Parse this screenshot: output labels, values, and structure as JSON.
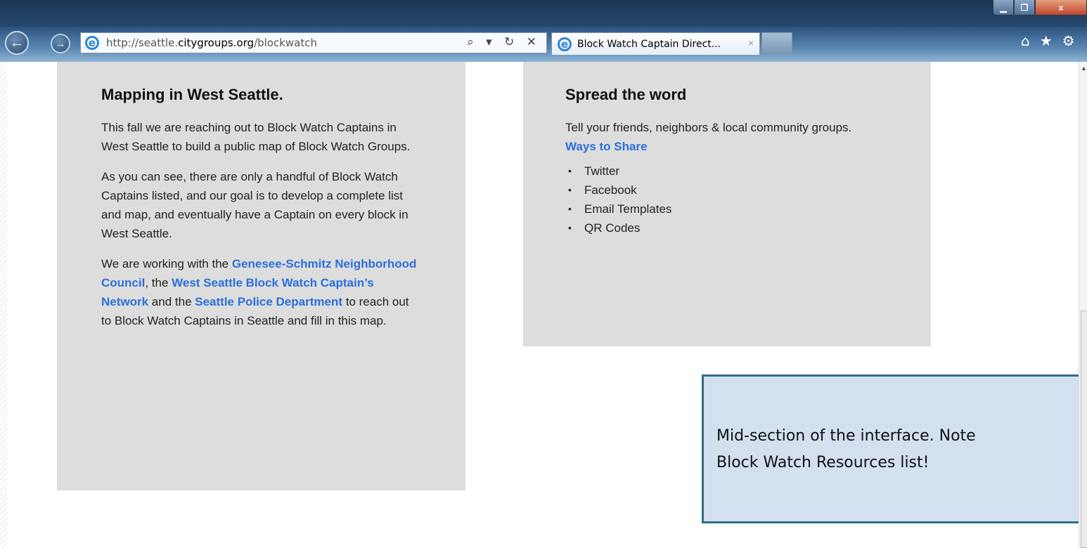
{
  "browser": {
    "address_protocol": "http://seattle.",
    "address_host": "citygroups.org",
    "address_path": "/blockwatch",
    "tab_title": "Block Watch Captain Direct...",
    "tab_close": "×",
    "addr_tools": "⌕ ▾ ↻ ✕",
    "window_close": "x"
  },
  "left_card": {
    "heading": "Mapping in West Seattle.",
    "para1": "This fall we are reaching out to Block Watch Captains in West Seattle to build a public map of Block Watch Groups.",
    "para2": "As you can see, there are only a handful of Block Watch Captains listed, and our goal is to develop a complete list and map, and eventually have a Captain on every block in West Seattle.",
    "para3_prefix": "We are working with the ",
    "link1": "Genesee-Schmitz Neighborhood Council",
    "para3_mid1": ", the ",
    "link2": "West Seattle Block Watch Captain’s Network",
    "para3_mid2": " and the ",
    "link3": "Seattle Police Department",
    "para3_suffix": " to reach out to Block Watch Captains in Seattle and fill in this map."
  },
  "right_card": {
    "heading": "Spread the word",
    "para": "Tell your friends, neighbors & local community groups.",
    "share_link": "Ways to Share",
    "items": [
      "Twitter",
      "Facebook",
      "Email Templates",
      "QR Codes"
    ]
  },
  "callout": {
    "text": "Mid-section of the interface. Note\nBlock Watch Resources list!"
  }
}
